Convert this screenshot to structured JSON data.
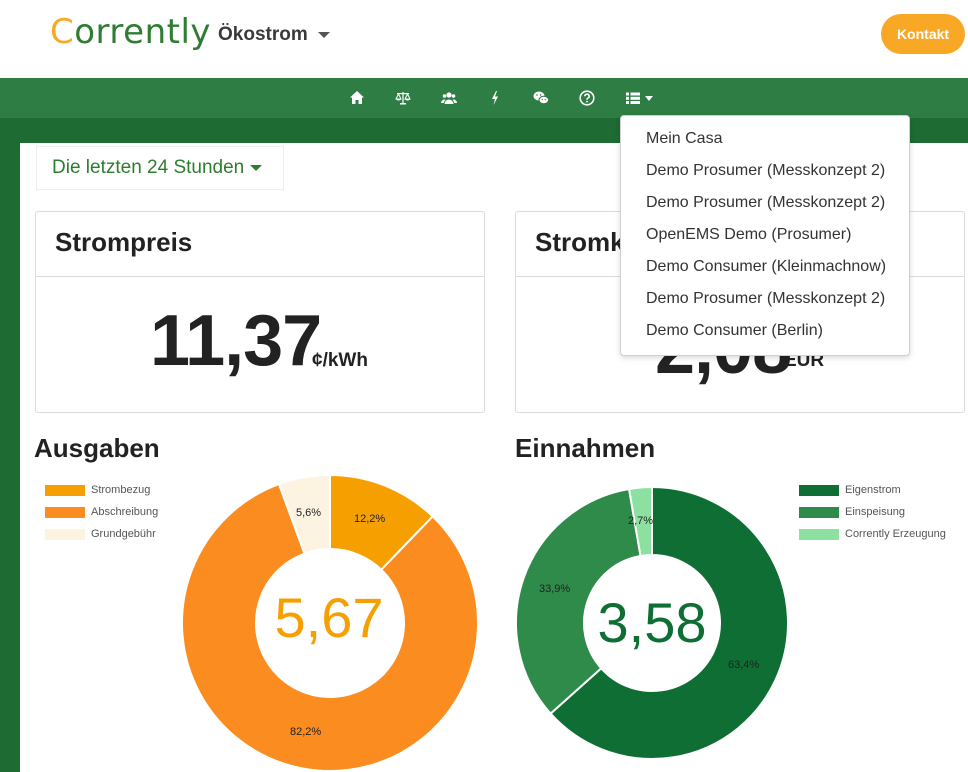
{
  "header": {
    "logo_first": "C",
    "logo_rest": "orrently",
    "menu_label": "Ökostrom",
    "contact_label": "Kontakt"
  },
  "nav": {
    "icons": [
      "home-icon",
      "balance-scale-icon",
      "users-icon",
      "lightning-icon",
      "wechat-icon",
      "question-circle-icon",
      "list-icon"
    ]
  },
  "range": {
    "label": "Die letzten 24 Stunden"
  },
  "strompreis": {
    "title": "Strompreis",
    "value": "11,37",
    "unit": "¢/kWh"
  },
  "stromkosten": {
    "title": "Stromk",
    "value": "2,08",
    "unit": "EUR"
  },
  "dropdown": {
    "items": [
      "Mein Casa",
      "Demo Prosumer (Messkonzept 2)",
      "Demo Prosumer (Messkonzept 2)",
      "OpenEMS Demo (Prosumer)",
      "Demo Consumer (Kleinmachnow)",
      "Demo Prosumer (Messkonzept 2)",
      "Demo Consumer (Berlin)"
    ]
  },
  "ausgaben": {
    "title": "Ausgaben",
    "center_value": "5,67",
    "center_color": "#f5a000"
  },
  "einnahmen": {
    "title": "Einnahmen",
    "center_value": "3,58",
    "center_color": "#0f6e34"
  },
  "colors": {
    "accent": "#f9a825",
    "nav_green": "#2e7d44"
  },
  "chart_data": [
    {
      "type": "pie",
      "title": "Ausgaben",
      "categories": [
        "Strombezug",
        "Abschreibung",
        "Grundgebühr"
      ],
      "values": [
        12.2,
        82.2,
        5.6
      ],
      "labels": [
        "12,2%",
        "82,2%",
        "5,6%"
      ],
      "colors": [
        "#f5a000",
        "#fb8c20",
        "#fdf3e1"
      ],
      "legend": "top-left"
    },
    {
      "type": "pie",
      "title": "Einnahmen",
      "categories": [
        "Eigenstrom",
        "Einspeisung",
        "Corrently Erzeugung"
      ],
      "values": [
        63.4,
        33.9,
        2.7
      ],
      "labels": [
        "63,4%",
        "33,9%",
        "2,7%"
      ],
      "colors": [
        "#0f6e34",
        "#2f8b4a",
        "#8ce0a0"
      ],
      "legend": "top-right"
    }
  ]
}
